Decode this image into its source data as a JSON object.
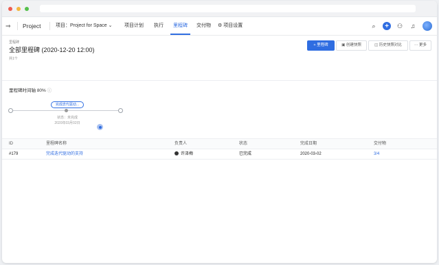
{
  "nav": {
    "brand": "Project",
    "project_label": "项目：Project for Space",
    "tabs": [
      {
        "label": "项目计划"
      },
      {
        "label": "执行"
      },
      {
        "label": "里程碑"
      },
      {
        "label": "交付物"
      },
      {
        "label": "项目设置"
      }
    ]
  },
  "header": {
    "breadcrumb": "里程碑",
    "title": "全部里程碑 (2020-12-20 12:00)",
    "count": "共1个",
    "buttons": {
      "add": "+ 里程碑",
      "snapshot": "创建快照",
      "compare": "历史快照对比",
      "more": "··· 更多"
    }
  },
  "timeline": {
    "title": "里程碑时间轴",
    "progress": "80%",
    "milestone_tag": "完成迭代驱动...",
    "status": "状态：未完成",
    "date": "2020年03月02日"
  },
  "table": {
    "columns": [
      "ID",
      "里程碑名称",
      "负责人",
      "状态",
      "完成日期",
      "交付物"
    ],
    "rows": [
      {
        "id": "#179",
        "name": "完成迭代驱动的支持",
        "owner": "许泽梅",
        "status": "已完成",
        "date": "2020-03-02",
        "deliverables": "3/4"
      }
    ]
  },
  "colors": {
    "accent": "#2f6de1"
  }
}
